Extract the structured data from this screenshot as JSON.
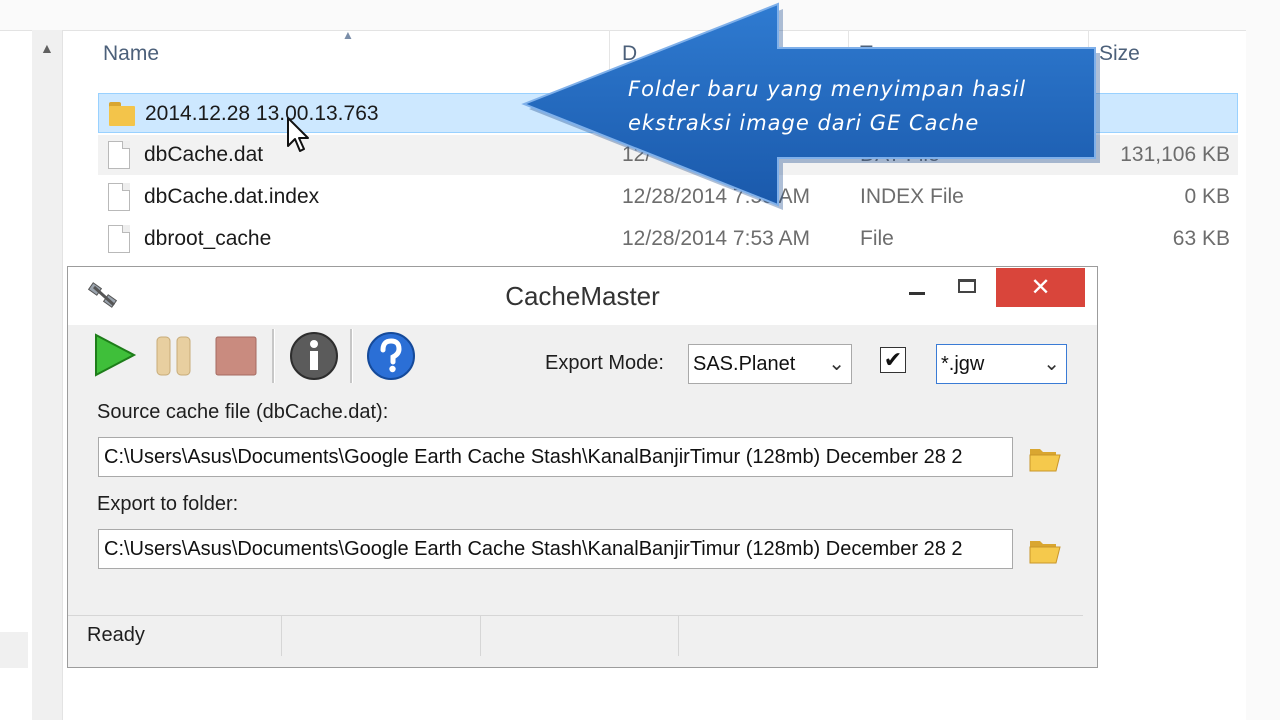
{
  "explorer": {
    "columns": {
      "name": "Name",
      "date": "D",
      "type": "T",
      "size": "Size"
    },
    "files": [
      {
        "name": "2014.12.28 13.00.13.763",
        "date": "",
        "type": "",
        "size": "",
        "icon": "folder-icon"
      },
      {
        "name": "dbCache.dat",
        "date": "12/",
        "type": "DAT File",
        "size": "131,106 KB",
        "icon": "document-icon"
      },
      {
        "name": "dbCache.dat.index",
        "date": "12/28/2014 7:53 AM",
        "type": "INDEX File",
        "size": "0 KB",
        "icon": "document-icon"
      },
      {
        "name": "dbroot_cache",
        "date": "12/28/2014 7:53 AM",
        "type": "File",
        "size": "63 KB",
        "icon": "document-icon"
      }
    ]
  },
  "callout": {
    "text": "Folder baru yang menyimpan hasil ekstraksi image dari GE Cache",
    "color": "#1f63b8"
  },
  "window": {
    "title": "CacheMaster",
    "close_label": "✕",
    "toolbar": {
      "play": "play-icon",
      "pause": "pause-icon",
      "stop": "stop-icon",
      "info": "info-icon",
      "help": "help-icon"
    },
    "export_mode_label": "Export Mode:",
    "export_mode_value": "SAS.Planet",
    "world_file_checked": true,
    "check_mark": "✔",
    "world_file_ext": "*.jgw",
    "source_label": "Source cache file (dbCache.dat):",
    "source_path": "C:\\Users\\Asus\\Documents\\Google Earth Cache Stash\\KanalBanjirTimur (128mb) December 28 2",
    "export_label": "Export to folder:",
    "export_path": "C:\\Users\\Asus\\Documents\\Google Earth Cache Stash\\KanalBanjirTimur (128mb) December 28 2",
    "status": "Ready"
  }
}
